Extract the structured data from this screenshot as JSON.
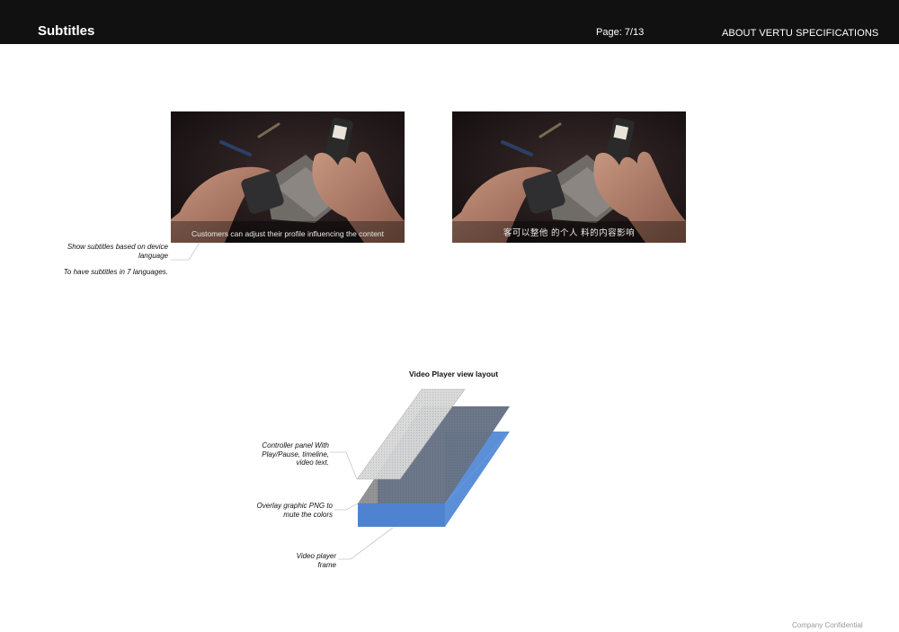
{
  "header": {
    "title": "Subtitles",
    "page": "Page: 7/13",
    "section": "ABOUT VERTU SPECIFICATIONS"
  },
  "examples": {
    "english_subtitle": "Customers can adjust their profile influencing the content",
    "chinese_subtitle": "客可以整他 的个人 料的内容影响"
  },
  "notes": {
    "device_language": "Show subtitles based on device language",
    "languages": "To have subtitles in 7 languages."
  },
  "diagram": {
    "title": "Video Player view layout",
    "controller_label": "Controller panel With Play/Pause, timeline, video text.",
    "overlay_label": "Overlay graphic  PNG to mute the colors",
    "frame_label": "Video player frame",
    "colors": {
      "controller": "#d8d8d8",
      "overlay": "#8e8e8e",
      "frame": "#5b8fd8"
    }
  },
  "footer": {
    "confidentiality": "Company Confidential"
  }
}
